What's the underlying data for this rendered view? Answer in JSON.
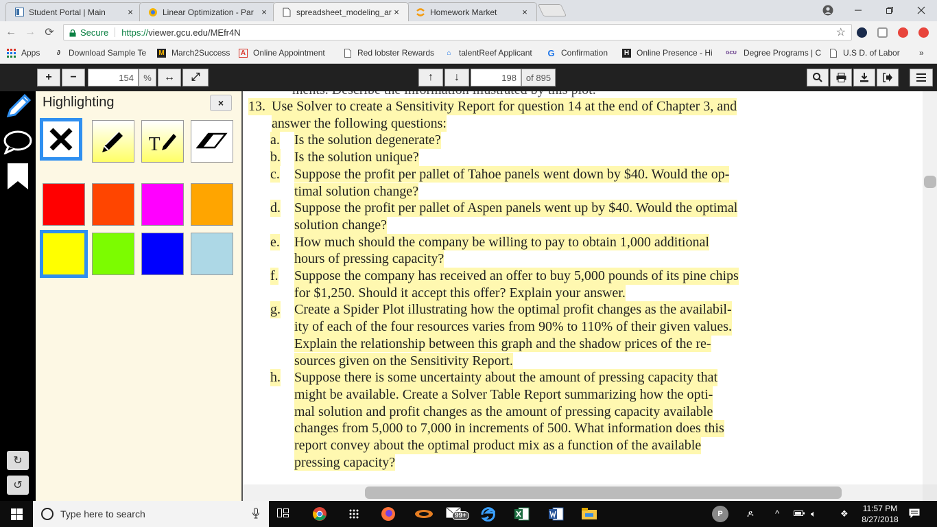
{
  "browser": {
    "tabs": [
      {
        "title": "Student Portal | Main",
        "close": "×"
      },
      {
        "title": "Linear Optimization - Par",
        "close": "×"
      },
      {
        "title": "spreadsheet_modeling_ar",
        "close": "×"
      },
      {
        "title": "Homework Market",
        "close": "×"
      }
    ],
    "address": {
      "secure_label": "Secure",
      "url_scheme": "https://",
      "url_rest": "viewer.gcu.edu/MEfr4N"
    },
    "bookmarks": [
      {
        "label": "Apps"
      },
      {
        "label": "Download Sample Te"
      },
      {
        "label": "March2Success"
      },
      {
        "label": "Online Appointment"
      },
      {
        "label": "Red lobster Rewards"
      },
      {
        "label": "talentReef Applicant"
      },
      {
        "label": "Confirmation"
      },
      {
        "label": "Online Presence - Hi"
      },
      {
        "label": "Degree Programs | C"
      },
      {
        "label": "U.S D. of Labor"
      }
    ],
    "bookmarks_overflow": "»",
    "bookmark_badges": {
      "confirmation": "G",
      "online_presence": "H",
      "degree_programs": "GCU"
    }
  },
  "viewer": {
    "zoom_value": "154",
    "zoom_unit": "%",
    "page_current": "198",
    "page_total": "of 895",
    "zoom_in": "+",
    "zoom_out": "−"
  },
  "panel": {
    "title": "Highlighting",
    "close": "×",
    "tools": [
      "clear-tool",
      "pen-tool",
      "text-tool",
      "eraser-tool"
    ],
    "text_tool_letter": "T",
    "selected_tool": "clear-tool",
    "colors": [
      "#ff0000",
      "#ff4500",
      "#ff00ff",
      "#ffa500",
      "#ffff00",
      "#7cfc00",
      "#0000ff",
      "#add8e6"
    ],
    "selected_color": "#ffff00"
  },
  "document": {
    "cut_line": "ments. Describe the information illustrated by this plot.",
    "question_number": "13.",
    "lines": [
      {
        "marker": "",
        "text": "Use Solver to create a Sensitivity Report for question 14 at the end of Chapter 3, and"
      },
      {
        "marker": "",
        "text": "answer the following questions:"
      },
      {
        "marker": "a.",
        "text": "Is the solution degenerate?"
      },
      {
        "marker": "b.",
        "text": "Is the solution unique?"
      },
      {
        "marker": "c.",
        "text": "Suppose the profit per pallet of Tahoe panels went down by $40. Would the op-"
      },
      {
        "marker": "",
        "text": "timal solution change?"
      },
      {
        "marker": "d.",
        "text": "Suppose the profit per pallet of Aspen panels went up by $40. Would the optimal"
      },
      {
        "marker": "",
        "text": "solution change?"
      },
      {
        "marker": "e.",
        "text": "How much should the company be willing to pay to obtain 1,000 additional"
      },
      {
        "marker": "",
        "text": "hours of pressing capacity?"
      },
      {
        "marker": "f.",
        "text": "Suppose the company has received an offer to buy 5,000 pounds of its pine chips"
      },
      {
        "marker": "",
        "text": "for $1,250. Should it accept this offer? Explain your answer."
      },
      {
        "marker": "g.",
        "text": "Create a Spider Plot illustrating how the optimal profit changes as the availabil-"
      },
      {
        "marker": "",
        "text": "ity of each of the four resources varies from 90% to 110% of their given values."
      },
      {
        "marker": "",
        "text": "Explain the relationship between this graph and the shadow prices of the re-"
      },
      {
        "marker": "",
        "text": "sources given on the Sensitivity Report."
      },
      {
        "marker": "h.",
        "text": "Suppose there is some uncertainty about the amount of pressing capacity that"
      },
      {
        "marker": "",
        "text": "might be available. Create a Solver Table Report summarizing how the opti-"
      },
      {
        "marker": "",
        "text": "mal solution and profit changes as the amount of pressing capacity available"
      },
      {
        "marker": "",
        "text": "changes from 5,000 to 7,000 in increments of 500. What information does this"
      },
      {
        "marker": "",
        "text": "report convey about the optimal product mix as a function of the available"
      },
      {
        "marker": "",
        "text": "pressing capacity?"
      }
    ],
    "highlight_color": "#fff8b0"
  },
  "taskbar": {
    "search_placeholder": "Type here to search",
    "mail_badge": "99+",
    "people_initial": "P",
    "time": "11:57 PM",
    "date": "8/27/2018"
  }
}
